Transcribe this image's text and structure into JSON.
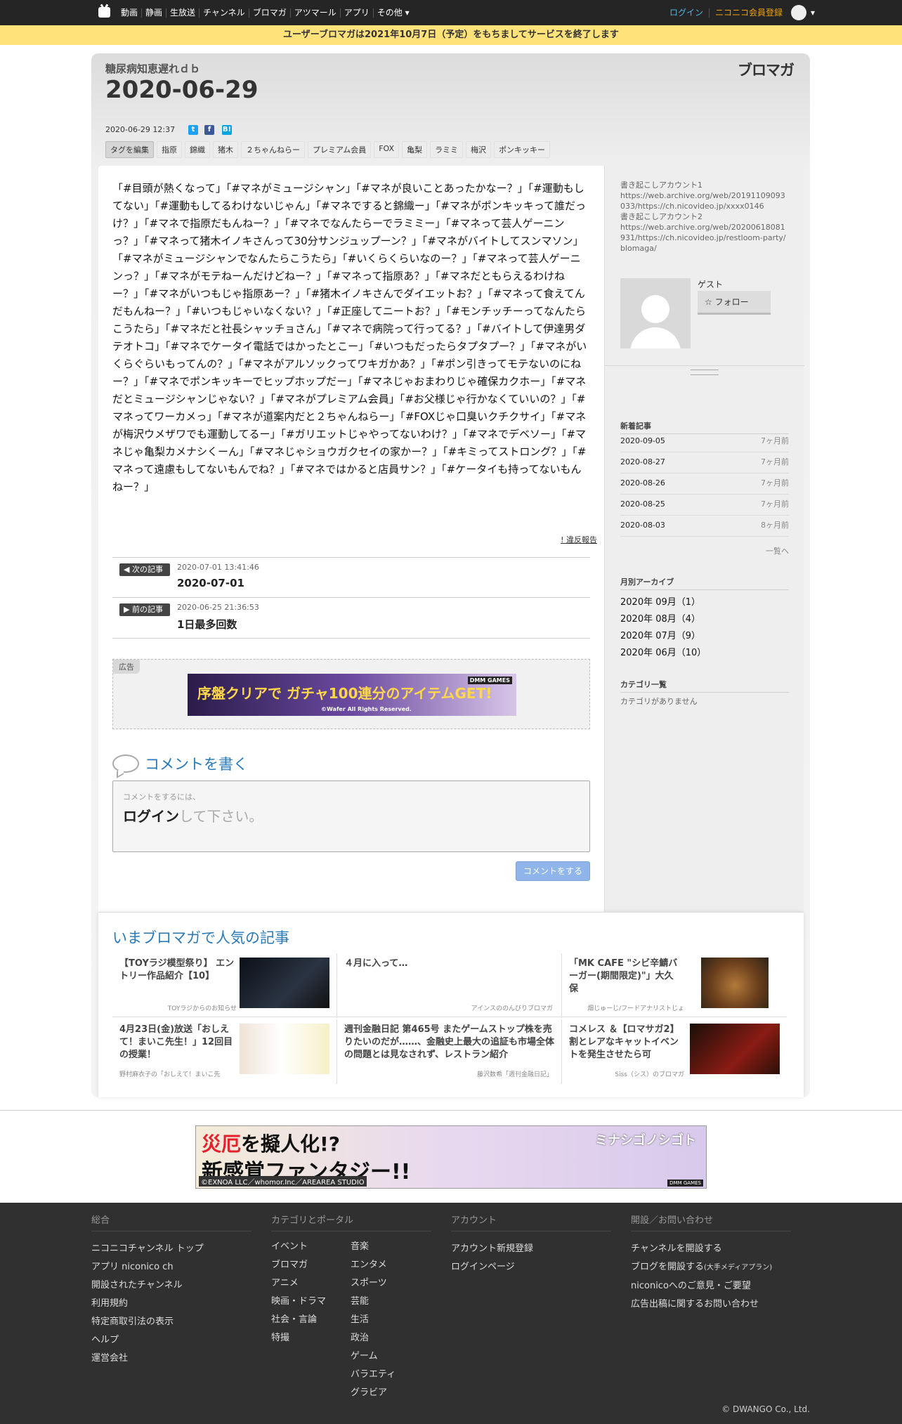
{
  "nav": {
    "items": [
      "動画",
      "静画",
      "生放送",
      "チャンネル",
      "ブロマガ",
      "アツマール",
      "アプリ",
      "その他"
    ],
    "login": "ログイン",
    "signup": "ニコニコ会員登録"
  },
  "notice": "ユーザーブロマガは2021年10月7日（予定）をもちましてサービスを終了します",
  "blog": {
    "name": "糖尿病知恵遅れｄｂ",
    "brand": "ブロマガ"
  },
  "article": {
    "title": "2020-06-29",
    "date": "2020-06-29 12:37",
    "share": [
      "t",
      "f",
      "B!"
    ],
    "tag_edit": "タグを編集",
    "tags": [
      "指原",
      "錦織",
      "猪木",
      "２ちゃんねらー",
      "プレミアム会員",
      "FOX",
      "亀梨",
      "ラミミ",
      "梅沢",
      "ポンキッキー"
    ],
    "body": "「#目頭が熱くなって」「#マネがミュージシャン」「#マネが良いことあったかなー？」「#運動もしてない」「#運動もしてるわけないじゃん」「#マネですると錦織ー」「#マネがポンキッキって誰だっけ？」「#マネで指原だもんねー？」「#マネでなんたらーでラミミー」「#マネって芸人ゲーニンっ？」「#マネって猪木イノキさんって30分サンジュップーン？」「#マネがバイトしてスンマソン」「#マネがミュージシャンでなんたらこうたら」「#いくらくらいなのー？」「#マネって芸人ゲーニンっ？」「#マネがモテねーんだけどねー？」「#マネって指原あ？」「#マネだともらえるわけねー？」「#マネがいつもじゃ指原あー？」「#猪木イノキさんでダイエットお？」「#マネって食えてんだもんねー？」「#いつもじゃいなくない？」「#正座してニートお？」「#モンチッチーってなんたらこうたら」「#マネだと社長シャッチョさん」「#マネで病院って行ってる？」「#バイトして伊達男ダテオトコ」「#マネでケータイ電話ではかったとこー」「#いつもだったらタプタプー？」「#マネがいくらぐらいもってんの？」「#マネがアルソックってワキガかあ？」「#ポン引きってモテないのにねー？」「#マネでポンキッキーでヒップホップだー」「#マネじゃおまわりじゃ確保カクホー」「#マネだとミュージシャンじゃない？」「#マネがプレミアム会員」「#お父様じゃ行かなくていいの？」「#マネってワーカメっ」「#マネが道案内だと２ちゃんねらー」「#FOXじゃ口臭いクチクサイ」「#マネが梅沢ウメザワでも運動してるー」「#ガリエットじゃやってないわけ？」「#マネでデベソー」「#マネじゃ亀梨カメナシくーん」「#マネじゃショウガクセイの家かー？」「#キミってストロング？」「#マネって遠慮もしてないもんでね？」「#マネではかると店員サン？」「#ケータイも持ってないもんねー？」",
    "report": "! 違反報告"
  },
  "pager": {
    "next_label": "次の記事",
    "next_date": "2020-07-01 13:41:46",
    "next_title": "2020-07-01",
    "prev_label": "前の記事",
    "prev_date": "2020-06-25 21:36:53",
    "prev_title": "1日最多回数"
  },
  "ad": {
    "label": "広告",
    "banner_text": "序盤クリアで ガチャ100連分のアイテムGET!",
    "banner_brand": "DMM GAMES",
    "banner_copy": "©Wafer All Rights Reserved."
  },
  "comment": {
    "title": "コメントを書く",
    "hint": "コメントをするには、",
    "login_strong": "ログイン",
    "login_rest": "して下さい。",
    "button": "コメントをする"
  },
  "sidebar": {
    "info": "書き起こしアカウント1\nhttps://web.archive.org/web/20191109093033/https://ch.nicovideo.jp/xxxx0146\n書き起こしアカウント2\nhttps://web.archive.org/web/20200618081931/https://ch.nicovideo.jp/restloom-party/blomaga/",
    "guest": "ゲスト",
    "follow": "フォロー",
    "recent_head": "新着記事",
    "recent": [
      {
        "date": "2020-09-05",
        "ago": "7ヶ月前"
      },
      {
        "date": "2020-08-27",
        "ago": "7ヶ月前"
      },
      {
        "date": "2020-08-26",
        "ago": "7ヶ月前"
      },
      {
        "date": "2020-08-25",
        "ago": "7ヶ月前"
      },
      {
        "date": "2020-08-03",
        "ago": "8ヶ月前"
      }
    ],
    "more": "一覧へ",
    "archive_head": "月別アーカイブ",
    "archive": [
      "2020年 09月（1）",
      "2020年 08月（4）",
      "2020年 07月（9）",
      "2020年 06月（10）"
    ],
    "category_head": "カテゴリ一覧",
    "category_empty": "カテゴリがありません"
  },
  "popular": {
    "title": "いまブロマガで人気の記事",
    "cards": [
      {
        "title": "【TOYラジ模型祭り】 エントリー作品紹介【10】",
        "source": "TOYラジからのお知らせ"
      },
      {
        "title": "４月に入って…",
        "source": "アインスののんびりブロマガ"
      },
      {
        "title": "「MK CAFE \"シビ辛鯖バーガー(期間限定)\"」大久保",
        "source": "畑じゅーじ/フードアナリストじょ"
      },
      {
        "title": "4月23日(金)放送「おしえて！まいこ先生！」12回目の授業！",
        "source": "野村麻衣子の「おしえて！まいこ先"
      },
      {
        "title": "週刊金融日記 第465号 またゲームストップ株を売りたいのだが……、金融史上最大の追証も市場全体の問題とは見なされず、レストラン紹介",
        "source": "藤沢数希「週刊金融日記」"
      },
      {
        "title": "コメレス ＆【ロマサガ2】割とレアなキャットイベントを発生させたら可",
        "source": "Siss（シス）のブロマガ"
      }
    ]
  },
  "bottom_ad": {
    "red": "災厄",
    "line1_rest": "を擬人化!?",
    "line2": "新感覚ファンタジー!!",
    "logo": "ミナシゴノシゴト",
    "copy": "©EXNOA LLC／whomor.Inc／AREAREA STUDIO",
    "dmm": "DMM GAMES"
  },
  "footer": {
    "col1_head": "総合",
    "col1": [
      "ニコニコチャンネル トップ",
      "アプリ niconico ch",
      "開設されたチャンネル",
      "利用規約",
      "特定商取引法の表示",
      "ヘルプ",
      "運営会社"
    ],
    "col2_head": "カテゴリとポータル",
    "col2a": [
      "イベント",
      "ブロマガ",
      "アニメ",
      "映画・ドラマ",
      "社会・言論",
      "特撮"
    ],
    "col2b": [
      "音楽",
      "エンタメ",
      "スポーツ",
      "芸能",
      "生活",
      "政治",
      "ゲーム",
      "バラエティ",
      "グラビア"
    ],
    "col3_head": "アカウント",
    "col3": [
      "アカウント新規登録",
      "ログインページ"
    ],
    "col4_head": "開設／お問い合わせ",
    "col4": [
      "チャンネルを開設する",
      "ブログを開設する",
      "niconicoへのご意見・ご要望",
      "広告出稿に関するお問い合わせ"
    ],
    "col4_small": "(大手メディアプラン)",
    "copyright": "© DWANGO Co., Ltd."
  }
}
